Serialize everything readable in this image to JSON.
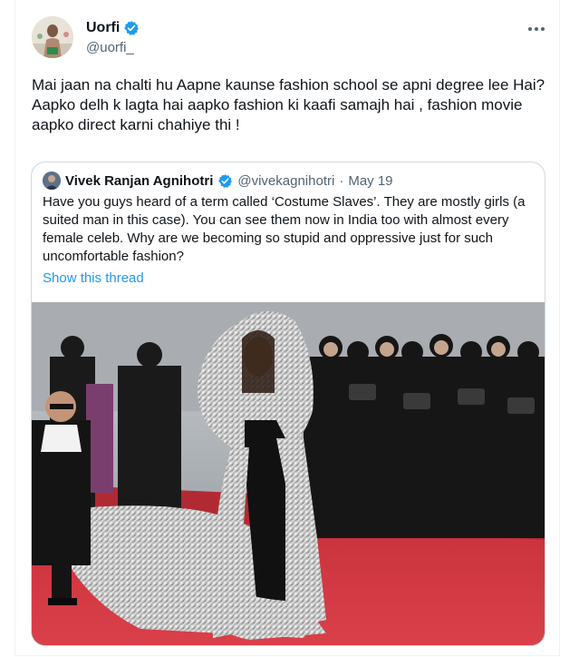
{
  "tweet": {
    "author_name": "Uorfi",
    "author_handle": "@uorfi_",
    "text": "Mai jaan na chalti hu Aapne kaunse fashion school se apni degree lee Hai?\nAapko delh k lagta hai aapko fashion ki kaafi samajh hai , fashion movie aapko direct karni chahiye thi !",
    "verified_color": "#1d9bf0"
  },
  "quoted_tweet": {
    "author_name": "Vivek Ranjan Agnihotri",
    "author_handle": "@vivekagnihotri",
    "separator": "·",
    "date": "May 19",
    "text": "Have you guys heard of a term called ‘Costume Slaves’. They are mostly girls (a suited man in this case). You can see them now in India too with almost every female celeb. Why are we becoming so stupid and oppressive just for such uncomfortable fashion?",
    "show_thread": "Show this thread",
    "link_color": "#1d9bf0"
  },
  "icons": {
    "verified": "verified-badge-icon",
    "more": "more-options-icon"
  }
}
